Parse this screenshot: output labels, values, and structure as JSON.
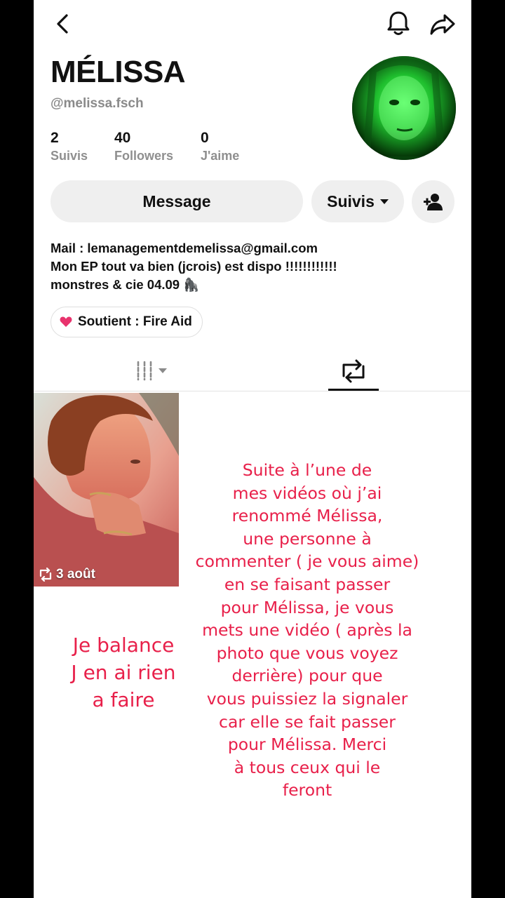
{
  "topbar": {
    "back_icon": "chevron-left-icon",
    "bell_icon": "bell-icon",
    "share_icon": "share-arrow-icon"
  },
  "profile": {
    "name": "MÉLISSA",
    "username": "@melissa.fsch",
    "stats": [
      {
        "value": "2",
        "label": "Suivis"
      },
      {
        "value": "40",
        "label": "Followers"
      },
      {
        "value": "0",
        "label": "J'aime"
      }
    ],
    "avatar_icon": "profile-photo"
  },
  "actions": {
    "message_label": "Message",
    "follow_label": "Suivis",
    "add_friend_icon": "add-friend-icon"
  },
  "bio": {
    "lines": [
      "Mail : lemanagementdemelissa@gmail.com",
      "Mon EP tout va bien (jcrois) est dispo !!!!!!!!!!!!",
      "monstres & cie 04.09 🦍"
    ]
  },
  "support": {
    "label": "Soutient : Fire Aid",
    "icon": "heart-icon",
    "color": "#e8336d"
  },
  "tabs": {
    "grid_icon": "grid-columns-icon",
    "repost_icon": "repost-icon"
  },
  "videos": [
    {
      "date": "3 août",
      "icon": "repost-icon"
    }
  ],
  "overlay": {
    "color": "#e8204a",
    "main_lines": [
      "Suite à l’une de",
      "mes vidéos où j’ai",
      "renommé Mélissa,",
      "une personne à",
      "commenter ( je vous aime)",
      "en se faisant passer",
      "pour Mélissa, je vous",
      "mets une vidéo ( après la",
      "photo que vous voyez",
      "derrière) pour que",
      "vous puissiez la signaler",
      "car elle se fait passer",
      "pour Mélissa. Merci",
      "à tous ceux qui le",
      "feront"
    ],
    "side_lines": [
      "Je balance",
      "J en ai rien",
      "a faire"
    ]
  }
}
